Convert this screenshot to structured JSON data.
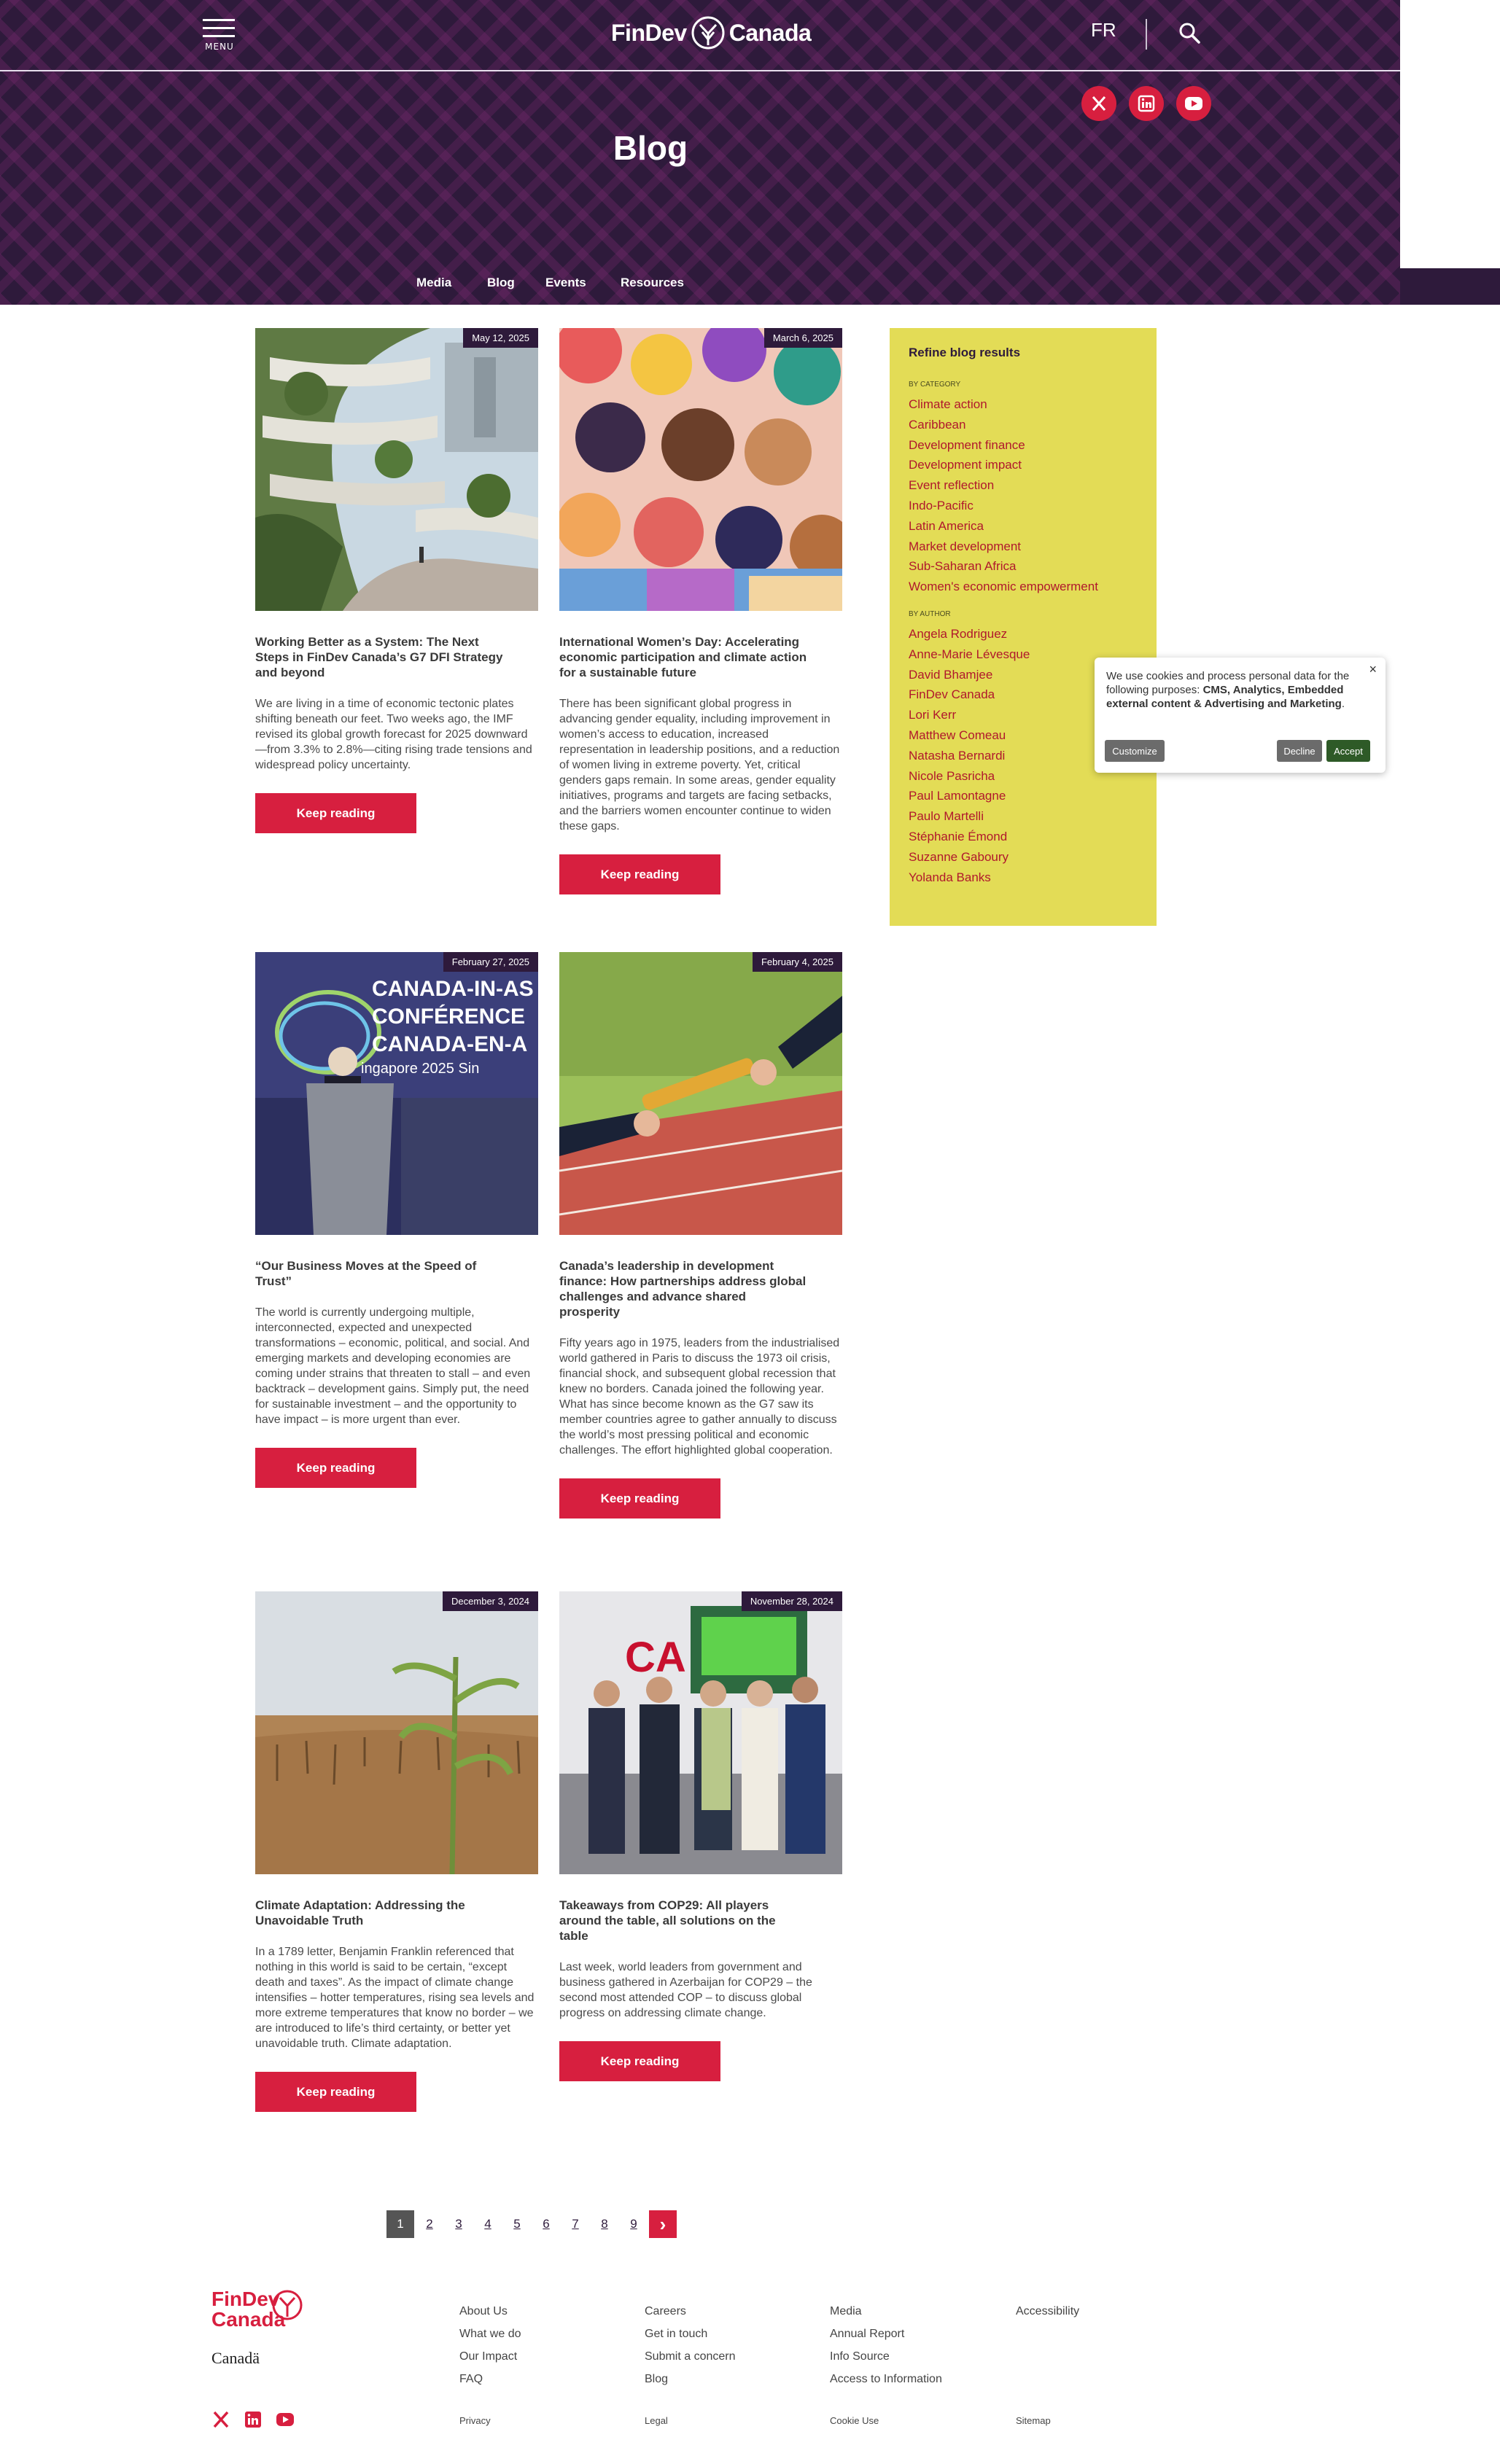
{
  "header": {
    "menu_label": "MENU",
    "logo_left": "FinDev",
    "logo_right": "Canada",
    "lang": "FR",
    "page_title": "Blog",
    "subnav": [
      "Media",
      "Blog",
      "Events",
      "Resources"
    ],
    "brand_color": "#d71f3f",
    "header_bg": "#2e1a3b"
  },
  "cards": [
    {
      "date": "May 12, 2025",
      "title": "Working Better as a System: The Next Steps in FinDev Canada’s G7 DFI Strategy and beyond",
      "excerpt": "We are living in a time of economic tectonic plates shifting beneath our feet. Two weeks ago, the IMF revised its global growth forecast for 2025 downward—from 3.3% to 2.8%—citing rising trade tensions and widespread policy uncertainty.",
      "button": "Keep reading"
    },
    {
      "date": "March 6, 2025",
      "title": "International Women’s Day: Accelerating economic participation and climate action for a sustainable future",
      "excerpt": "There has been significant global progress in advancing gender equality, including improvement in women’s access to education, increased representation in leadership positions, and a reduction of women living in extreme poverty. Yet, critical genders gaps remain. In some areas, gender equality initiatives, programs and targets are facing setbacks, and the barriers women encounter continue to widen these gaps.",
      "button": "Keep reading"
    },
    {
      "date": "February 27, 2025",
      "title": "“Our Business Moves at the Speed of Trust”",
      "excerpt": "The world is currently undergoing multiple, interconnected, expected and unexpected transformations – economic, political, and social. And emerging markets and developing economies are coming under strains that threaten to stall – and even backtrack – development gains. Simply put, the need for sustainable investment – and the opportunity to have impact – is more urgent than ever.",
      "button": "Keep reading",
      "img_text": [
        "CANADA-IN-AS",
        "CONFÉRENCE",
        "CANADA-EN-A",
        "ingapore 2025 Sin"
      ]
    },
    {
      "date": "February 4, 2025",
      "title": "Canada’s leadership in development finance: How partnerships address global challenges and advance shared prosperity",
      "excerpt": "Fifty years ago in 1975, leaders from the industrialised world gathered in Paris to discuss the 1973 oil crisis, financial shock, and subsequent global recession that knew no borders. Canada joined the following year. What has since become known as the G7 saw its member countries agree to gather annually to discuss the world’s most pressing political and economic challenges. The effort highlighted global cooperation.",
      "button": "Keep reading"
    },
    {
      "date": "December 3, 2024",
      "title": "Climate Adaptation: Addressing the Unavoidable Truth",
      "excerpt": "In a 1789 letter, Benjamin Franklin referenced that nothing in this world is said to be certain, “except death and taxes”. As the impact of climate change intensifies – hotter temperatures, rising sea levels and more extreme temperatures that know no border – we are introduced to life’s third certainty, or better yet unavoidable truth. Climate adaptation.",
      "button": "Keep reading"
    },
    {
      "date": "November 28, 2024",
      "title": "Takeaways from COP29: All players around the table, all solutions on the table",
      "excerpt": "Last week, world leaders from government and business gathered in Azerbaijan for COP29 – the second most attended COP – to discuss global progress on addressing climate change.",
      "button": "Keep reading",
      "img_text": [
        "CA"
      ]
    }
  ],
  "sidebar": {
    "title": "Refine blog results",
    "category_head": "BY CATEGORY",
    "categories": [
      "Climate action",
      "Caribbean",
      "Development finance",
      "Development impact",
      "Event reflection",
      "Indo-Pacific",
      "Latin America",
      "Market development",
      "Sub-Saharan Africa",
      "Women's economic empowerment"
    ],
    "author_head": "BY AUTHOR",
    "authors": [
      "Angela Rodriguez",
      "Anne-Marie Lévesque",
      "David Bhamjee",
      "FinDev Canada",
      "Lori Kerr",
      "Matthew Comeau",
      "Natasha Bernardi",
      "Nicole Pasricha",
      "Paul Lamontagne",
      "Paulo Martelli",
      "Stéphanie Émond",
      "Suzanne Gaboury",
      "Yolanda Banks"
    ],
    "bg": "#e3dc56"
  },
  "cookie": {
    "text_plain": "We use cookies and process personal data for the following purposes: ",
    "text_bold": "CMS, Analytics, Embedded external content & Advertising and Marketing",
    "text_end": ".",
    "close": "×",
    "customize": "Customize",
    "decline": "Decline",
    "accept": "Accept"
  },
  "pagination": {
    "pages": [
      "1",
      "2",
      "3",
      "4",
      "5",
      "6",
      "7",
      "8",
      "9"
    ],
    "current": "1",
    "next": "›"
  },
  "footer": {
    "logo_line1": "FinDev",
    "logo_line2": "Canada",
    "canada_wordmark": "Canadä",
    "col1": [
      "About Us",
      "What we do",
      "Our Impact",
      "FAQ"
    ],
    "col2": [
      "Careers",
      "Get in touch",
      "Submit a concern",
      "Blog"
    ],
    "col3": [
      "Media",
      "Annual Report",
      "Info Source",
      "Access to Information"
    ],
    "col4": [
      "Accessibility"
    ],
    "bottom": [
      "Privacy",
      "Legal",
      "Cookie Use",
      "Sitemap"
    ]
  }
}
